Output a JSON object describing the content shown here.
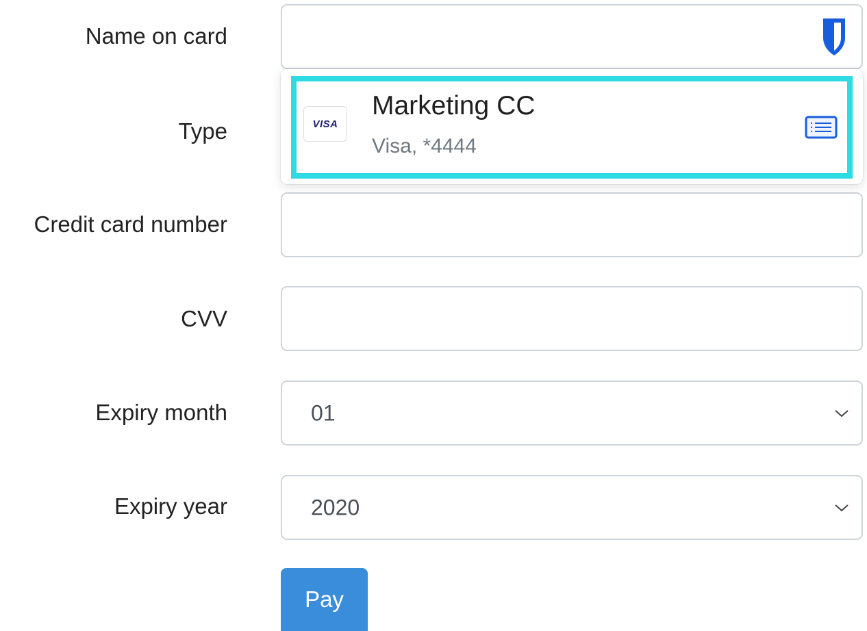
{
  "form": {
    "labels": {
      "name_on_card": "Name on card",
      "type": "Type",
      "credit_card_number": "Credit card number",
      "cvv": "CVV",
      "expiry_month": "Expiry month",
      "expiry_year": "Expiry year"
    },
    "values": {
      "name_on_card": "",
      "credit_card_number": "",
      "cvv": "",
      "expiry_month": "01",
      "expiry_year": "2020"
    },
    "pay_label": "Pay"
  },
  "autofill": {
    "icon": "bitwarden-shield-icon",
    "item": {
      "brand": "VISA",
      "title": "Marketing CC",
      "subtitle": "Visa, *4444",
      "action_icon": "card-icon"
    }
  },
  "colors": {
    "highlight_border": "#2edbe3",
    "pay_button": "#3a8ddb",
    "shield": "#175ddc",
    "field_border": "#ced4da"
  }
}
